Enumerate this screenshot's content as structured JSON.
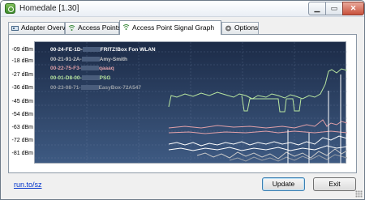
{
  "window": {
    "title": "Homedale [1.30]"
  },
  "tabs": [
    {
      "label": "Adapter Overview",
      "active": false,
      "icon": "adapter-icon"
    },
    {
      "label": "Access Points",
      "active": false,
      "icon": "wifi-icon"
    },
    {
      "label": "Access Point Signal Graph",
      "active": true,
      "icon": "wifi-graph-icon"
    },
    {
      "label": "Options",
      "active": false,
      "icon": "gear-icon"
    }
  ],
  "graph": {
    "y_labels": [
      "-09 dBm",
      "-18 dBm",
      "-27 dBm",
      "-36 dBm",
      "-45 dBm",
      "-54 dBm",
      "-63 dBm",
      "-72 dBm",
      "-81 dBm"
    ],
    "legend": [
      {
        "mac": "00-24-FE-1D-",
        "name": "FRITZ!Box Fon WLAN",
        "color": "#ffffff"
      },
      {
        "mac": "00-21-91-2A-",
        "name": "Amy-Smith",
        "color": "#c8c8c8"
      },
      {
        "mac": "00-22-75-F3-",
        "name": "qaaaq",
        "color": "#e0a0a8"
      },
      {
        "mac": "00-01-D8-00-",
        "name": "PSG",
        "color": "#b8e6a0"
      },
      {
        "mac": "00-23-08-71-",
        "name": "EasyBox-72A547",
        "color": "#9aa0a8"
      }
    ],
    "colors": {
      "background_top": "#1c2b47",
      "background_bottom": "#3e5a82",
      "grid": "#6a7fa0"
    }
  },
  "footer": {
    "link": "run.to/sz",
    "update_label": "Update",
    "exit_label": "Exit"
  }
}
